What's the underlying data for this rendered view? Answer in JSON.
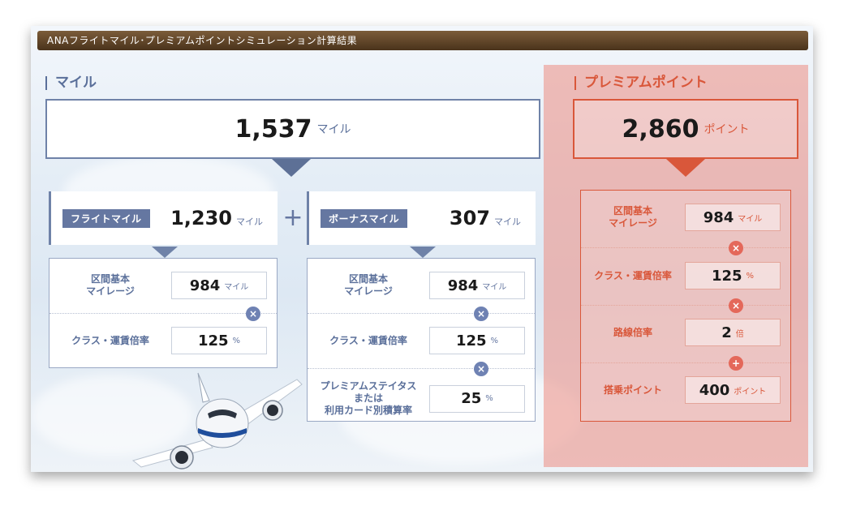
{
  "title": "ANAフライトマイル･プレミアムポイントシミュレーション計算結果",
  "miles": {
    "heading": "マイル",
    "total_value": "1,537",
    "total_unit": "マイル",
    "flight": {
      "badge": "フライトマイル",
      "value": "1,230",
      "unit": "マイル",
      "rows": [
        {
          "label_line1": "区間基本",
          "label_line2": "マイレージ",
          "value": "984",
          "unit": "マイル"
        },
        {
          "label": "クラス・運賃倍率",
          "value": "125",
          "unit": "%"
        }
      ]
    },
    "bonus": {
      "badge": "ボーナスマイル",
      "value": "307",
      "unit": "マイル",
      "rows": [
        {
          "label_line1": "区間基本",
          "label_line2": "マイレージ",
          "value": "984",
          "unit": "マイル"
        },
        {
          "label": "クラス・運賃倍率",
          "value": "125",
          "unit": "%"
        },
        {
          "label_line1": "プレミアムステイタス",
          "label_line2": "または",
          "label_line3": "利用カード別積算率",
          "value": "25",
          "unit": "%"
        }
      ]
    }
  },
  "premium_points": {
    "heading": "プレミアムポイント",
    "total_value": "2,860",
    "total_unit": "ポイント",
    "rows": [
      {
        "label_line1": "区間基本",
        "label_line2": "マイレージ",
        "value": "984",
        "unit": "マイル"
      },
      {
        "label": "クラス・運賃倍率",
        "value": "125",
        "unit": "%"
      },
      {
        "label": "路線倍率",
        "value": "2",
        "unit": "倍"
      },
      {
        "label": "搭乗ポイント",
        "value": "400",
        "unit": "ポイント"
      }
    ]
  },
  "icons": {
    "plus": "plus-icon",
    "multiply": "multiply-icon",
    "add": "plus-circle-icon"
  },
  "colors": {
    "miles_accent": "#6577a1",
    "premium_accent": "#d9573a",
    "title_bar": "#5c4226"
  }
}
